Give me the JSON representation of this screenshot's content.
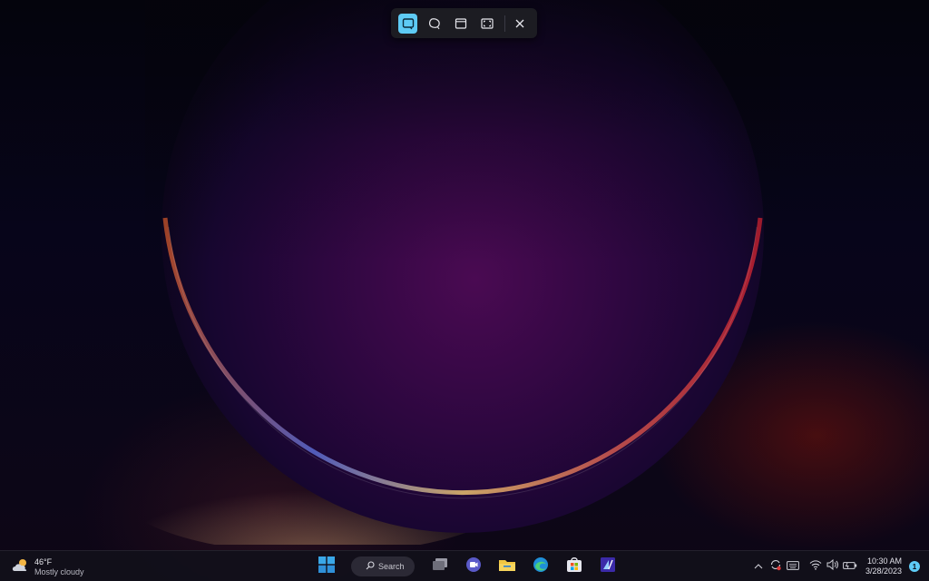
{
  "snipping_toolbar": {
    "modes": [
      {
        "name": "rectangle-mode",
        "icon": "rectangle-snip-icon",
        "active": true
      },
      {
        "name": "freeform-mode",
        "icon": "freeform-snip-icon",
        "active": false
      },
      {
        "name": "window-mode",
        "icon": "window-snip-icon",
        "active": false
      },
      {
        "name": "fullscreen-mode",
        "icon": "fullscreen-snip-icon",
        "active": false
      }
    ],
    "close_icon": "close-icon",
    "accent_color": "#5ecbf5"
  },
  "taskbar": {
    "weather": {
      "temperature": "46°F",
      "condition": "Mostly cloudy",
      "icon": "cloud-sun-icon"
    },
    "search": {
      "label": "Search"
    },
    "apps": [
      {
        "name": "start",
        "icon": "windows-start-icon"
      },
      {
        "name": "task-view",
        "icon": "task-view-icon"
      },
      {
        "name": "teams-chat",
        "icon": "chat-icon"
      },
      {
        "name": "file-explorer",
        "icon": "folder-icon"
      },
      {
        "name": "edge",
        "icon": "edge-icon"
      },
      {
        "name": "store",
        "icon": "store-icon"
      },
      {
        "name": "app",
        "icon": "app-icon"
      }
    ],
    "tray": {
      "icons": [
        "chevron-up-icon",
        "sync-icon",
        "keyboard-icon",
        "wifi-icon",
        "volume-icon",
        "battery-icon"
      ],
      "time": "10:30 AM",
      "date": "3/28/2023",
      "notification_count": "1"
    }
  }
}
